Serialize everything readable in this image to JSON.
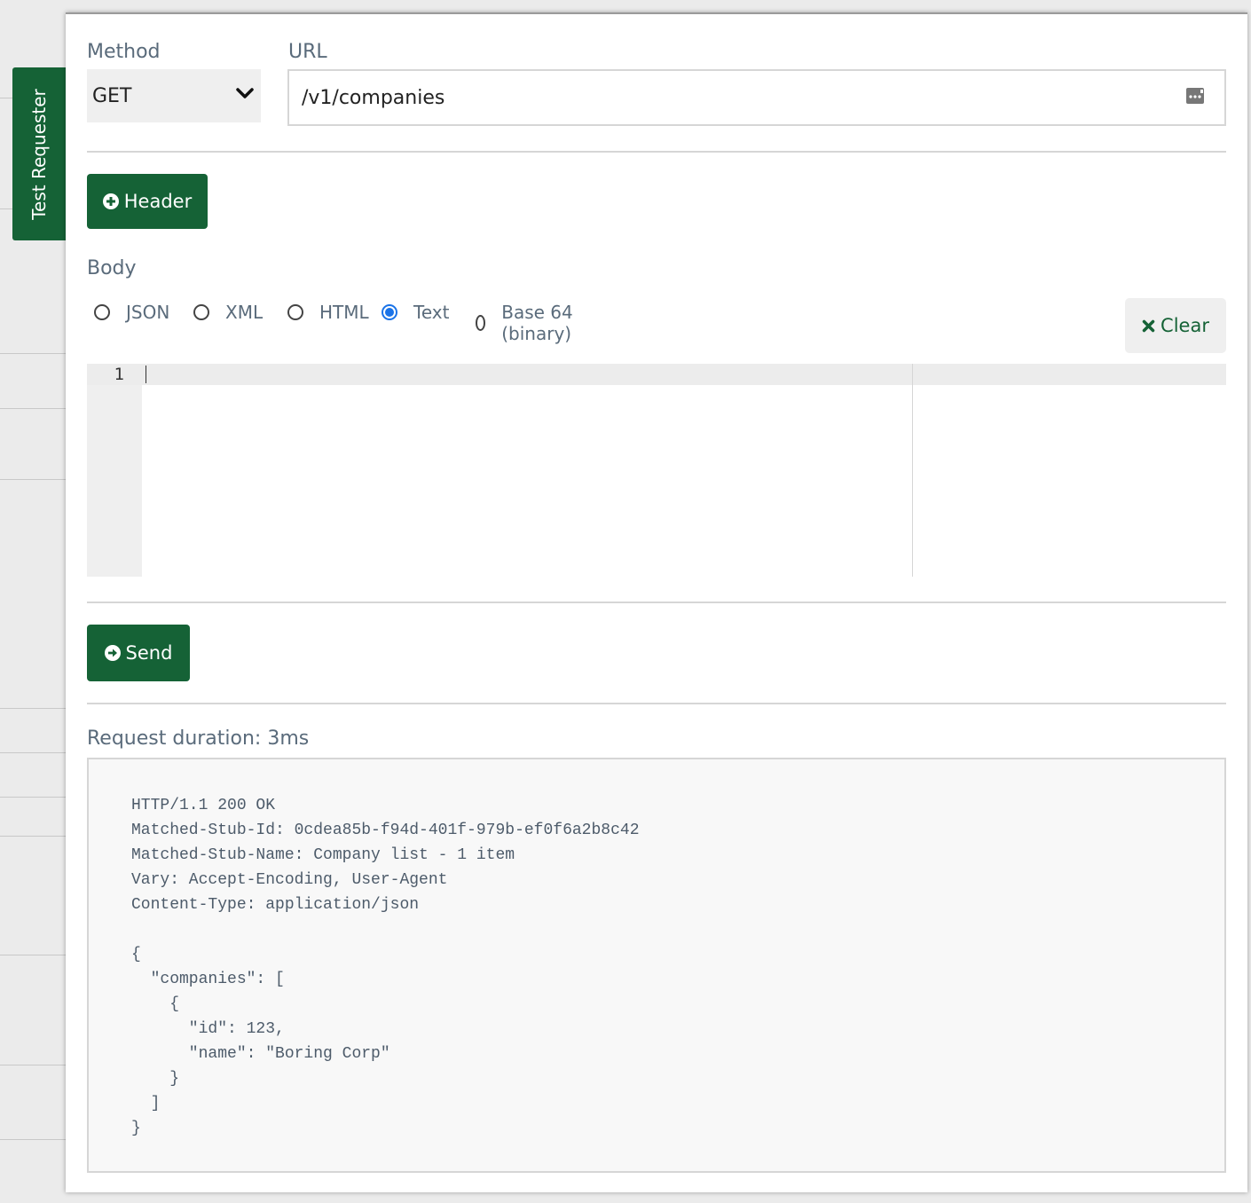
{
  "sidebar": {
    "tab_label": "Test Requester"
  },
  "form": {
    "method_label": "Method",
    "method_value": "GET",
    "url_label": "URL",
    "url_value": "/v1/companies",
    "header_button": "Header",
    "body_label": "Body",
    "body_types": [
      {
        "label": "JSON",
        "selected": false
      },
      {
        "label": "XML",
        "selected": false
      },
      {
        "label": "HTML",
        "selected": false
      },
      {
        "label": "Text",
        "selected": true
      },
      {
        "label": "Base 64 (binary)",
        "selected": false
      }
    ],
    "clear_button": "Clear",
    "editor_line_number": "1",
    "send_button": "Send"
  },
  "response": {
    "duration_text": "Request duration: 3ms",
    "body_text": "HTTP/1.1 200 OK\nMatched-Stub-Id: 0cdea85b-f94d-401f-979b-ef0f6a2b8c42\nMatched-Stub-Name: Company list - 1 item\nVary: Accept-Encoding, User-Agent\nContent-Type: application/json\n\n{\n  \"companies\": [\n    {\n      \"id\": 123,\n      \"name\": \"Boring Corp\"\n    }\n  ]\n}"
  },
  "colors": {
    "brand_green": "#156236",
    "radio_selected": "#1a73e8",
    "label_text": "#5a6b7b"
  },
  "icons": {
    "method_dropdown": "chevron-down-icon",
    "url_helper": "ellipsis-box-icon",
    "header_button": "plus-circle-icon",
    "clear_button": "x-mark-icon",
    "send_button": "arrow-right-circle-icon"
  }
}
